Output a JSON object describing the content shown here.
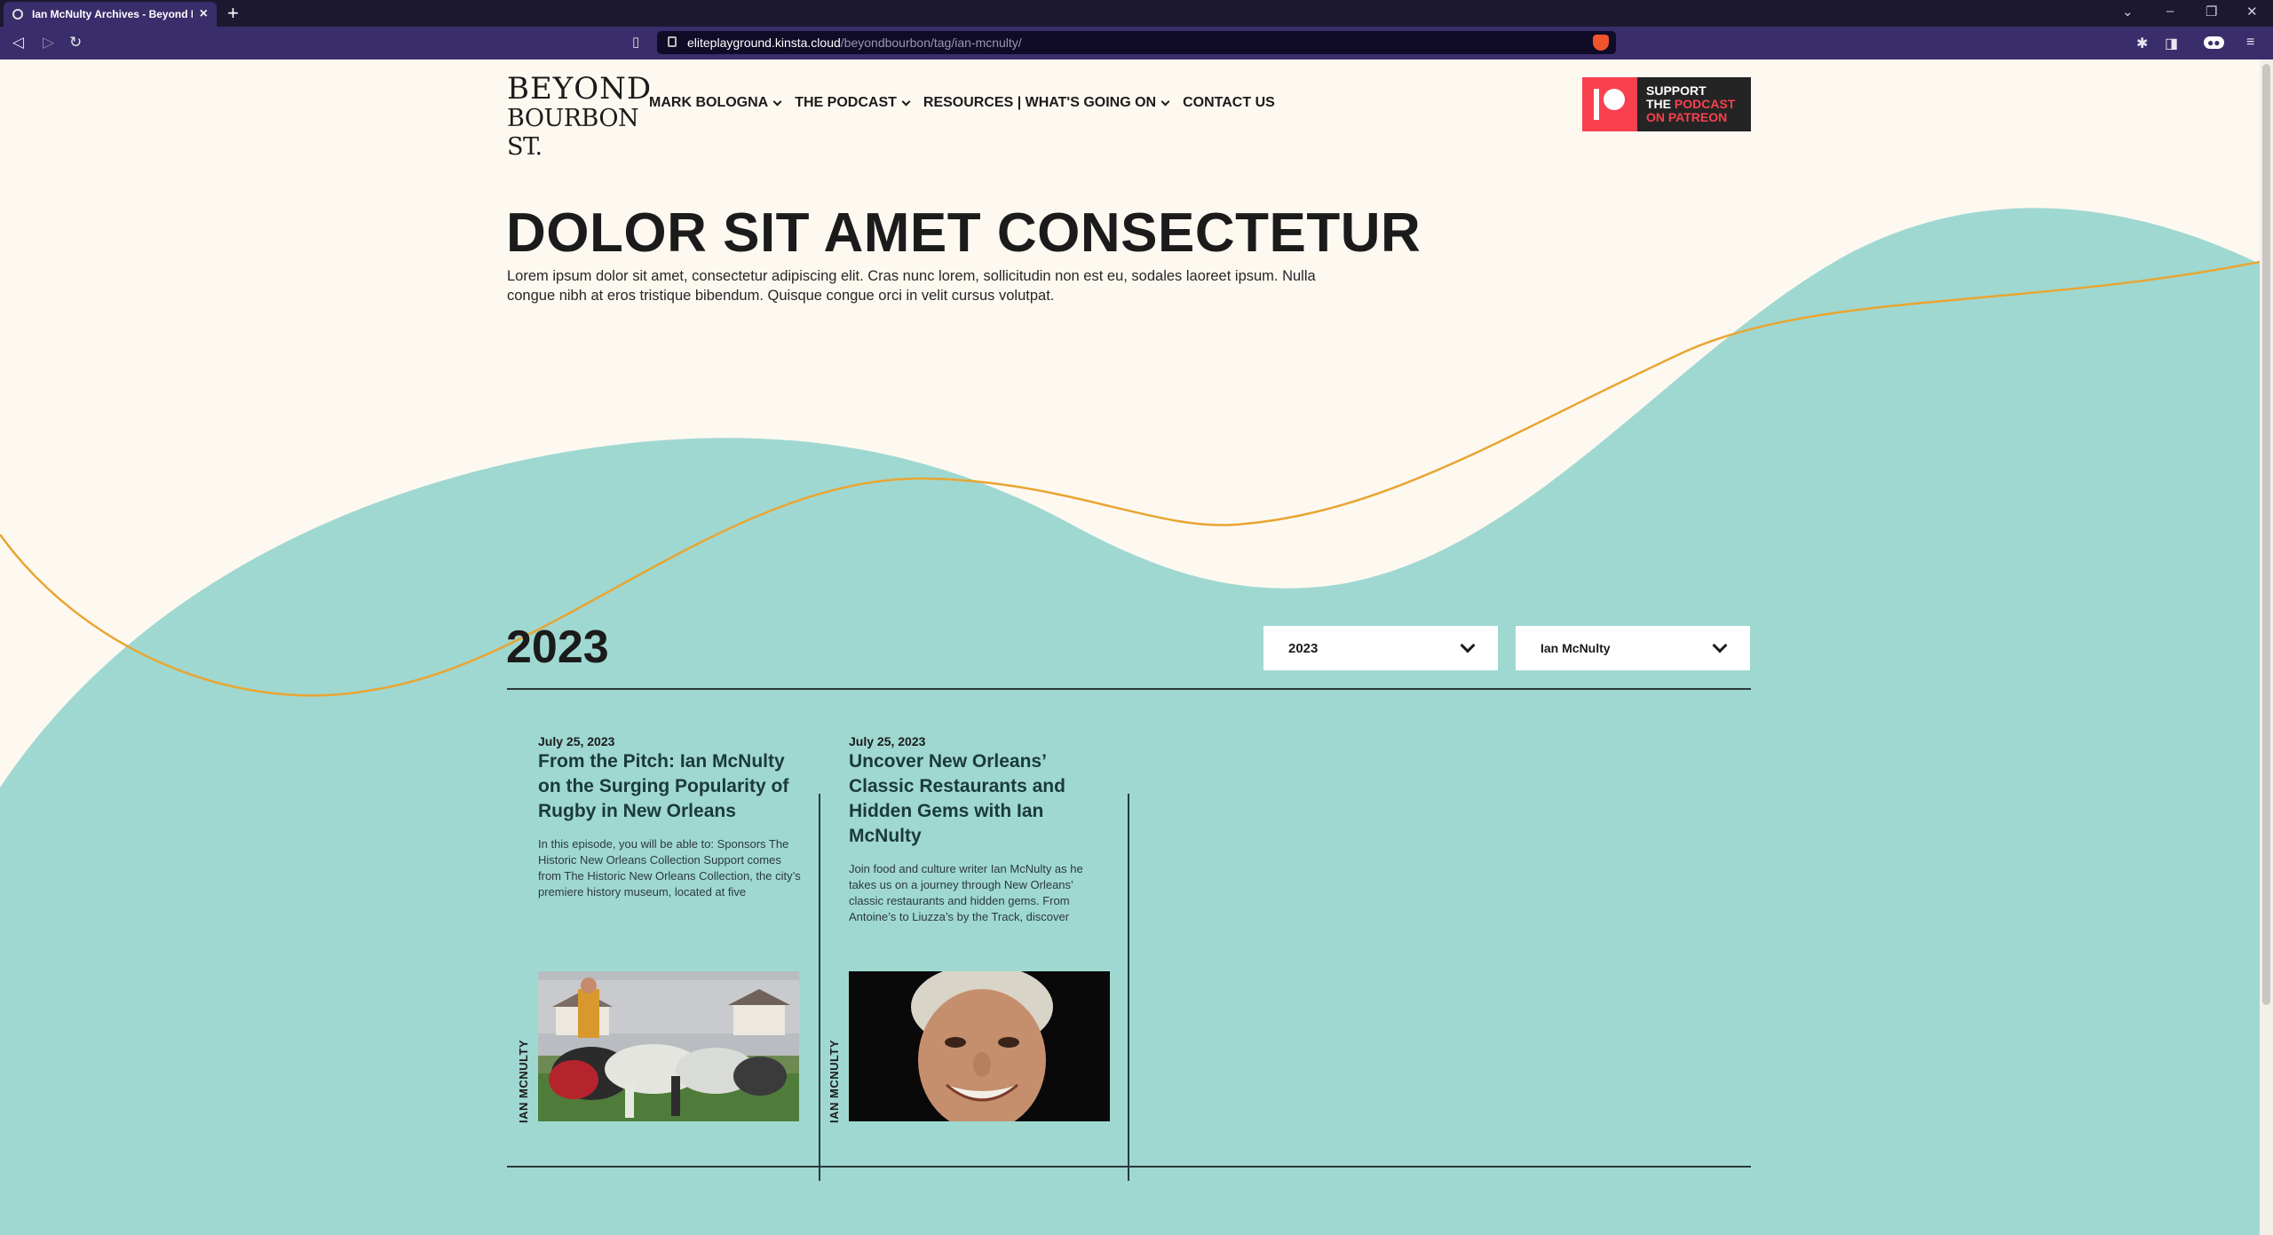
{
  "browser": {
    "tab_title": "Ian McNulty Archives - Beyond B",
    "url_host": "eliteplayground.kinsta.cloud",
    "url_path": "/beyondbourbon/tag/ian-mcnulty/"
  },
  "site": {
    "logo_line1": "BEYOND",
    "logo_line2": "BOURBON ST.",
    "nav": [
      {
        "label": "MARK BOLOGNA"
      },
      {
        "label": "THE PODCAST"
      },
      {
        "label": "RESOURCES | WHAT'S GOING ON"
      },
      {
        "label": "CONTACT US"
      }
    ],
    "patreon": {
      "line1": "SUPPORT",
      "line2a": "THE ",
      "line2b": "PODCAST",
      "line3": "ON PATREON"
    },
    "colors": {
      "background": "#fdf9f1",
      "wave": "#9fd8d1",
      "curve": "#e9a531",
      "patreon_red": "#f9404e"
    }
  },
  "hero": {
    "title": "DOLOR SIT AMET CONSECTETUR",
    "text": "Lorem ipsum dolor sit amet, consectetur adipiscing elit. Cras nunc lorem, sollicitudin non est eu, sodales laoreet ipsum. Nulla congue nibh at eros tristique bibendum. Quisque congue orci in velit cursus volutpat."
  },
  "archive": {
    "year_heading": "2023",
    "filters": {
      "year": "2023",
      "author": "Ian McNulty"
    },
    "posts": [
      {
        "date": "July 25, 2023",
        "title": "From the Pitch: Ian McNulty on the Surging Popularity of Rugby in New Orleans",
        "excerpt": "In this episode, you will be able to: Sponsors The Historic New Orleans Collection Support comes from The Historic New Orleans Collection, the city’s premiere history museum, located at five",
        "tag": "IAN MCNULTY",
        "image": "rugby-scrum-photo"
      },
      {
        "date": "July 25, 2023",
        "title": "Uncover New Orleans’ Classic Restaurants and Hidden Gems with Ian McNulty",
        "excerpt": "Join food and culture writer Ian McNulty as he takes us on a journey through New Orleans’ classic restaurants and hidden gems. From Antoine’s to Liuzza’s by the Track, discover",
        "tag": "IAN MCNULTY",
        "image": "portrait-photo"
      }
    ]
  }
}
